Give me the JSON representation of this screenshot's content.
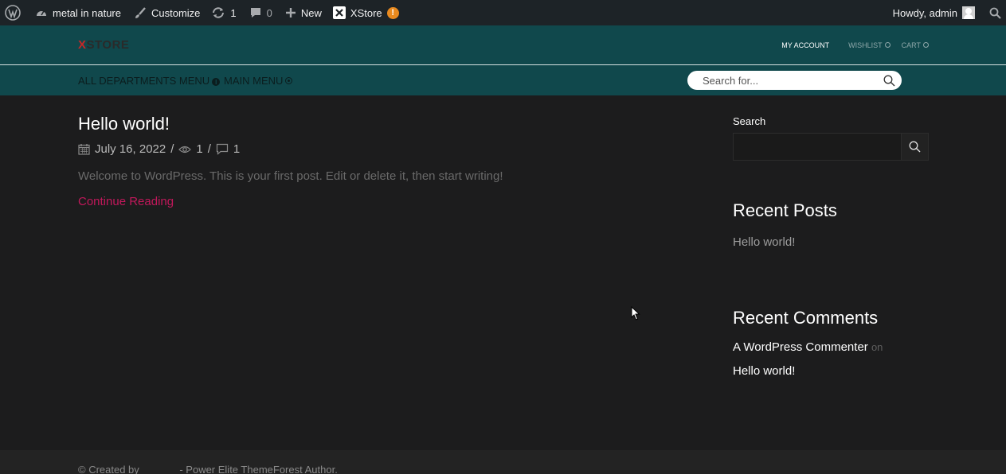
{
  "admin_bar": {
    "site_name": "metal in nature",
    "customize": "Customize",
    "updates_count": "1",
    "comments_count": "0",
    "new_label": "New",
    "xstore_label": "XStore",
    "warning_glyph": "!",
    "greeting": "Howdy, admin"
  },
  "header": {
    "logo_x": "X",
    "logo_text": "STORE",
    "my_account": "MY ACCOUNT",
    "wishlist": "WISHLIST",
    "cart": "CART",
    "all_departments": "ALL DEPARTMENTS MENU",
    "dept_badge": "i",
    "main_menu": "MAIN MENU",
    "search_placeholder": "Search for..."
  },
  "post": {
    "title": "Hello world!",
    "date": "July 16, 2022",
    "views": "1",
    "comments": "1",
    "separator": "/",
    "excerpt": "Welcome to WordPress. This is your first post. Edit or delete it, then start writing!",
    "continue_label": "Continue Reading"
  },
  "sidebar": {
    "search_label": "Search",
    "recent_posts_heading": "Recent Posts",
    "recent_posts": [
      "Hello world!"
    ],
    "recent_comments_heading": "Recent Comments",
    "commenter": "A WordPress Commenter",
    "on_label": "on",
    "comment_post": "Hello world!"
  },
  "footer": {
    "text": "© Created by              - Power Elite ThemeForest Author."
  },
  "colors": {
    "admin_bar_bg": "#1d2327",
    "header_bg": "#10484c",
    "page_bg": "#1c1c1d",
    "accent_link": "#c2185b",
    "logo_x": "#c62828",
    "warning": "#e88a1f"
  }
}
